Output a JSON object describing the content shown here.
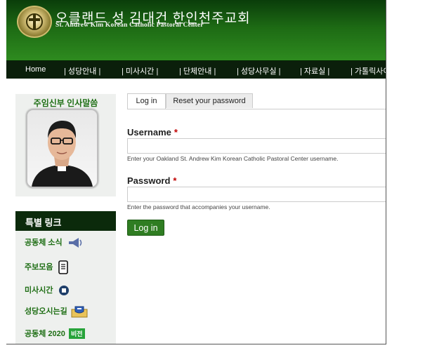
{
  "header": {
    "title_ko": "오클랜드 성 김대건 한인천주교회",
    "title_en": "St. Andrew Kim Korean Catholic Pastoral Center"
  },
  "nav": {
    "items": [
      "Home",
      "| 성당안내 |",
      "| 미사시간 |",
      "| 단체안내 |",
      "| 성당사무실 |",
      "| 자료실 |",
      "| 가톨릭사이"
    ]
  },
  "sidebar": {
    "pastor_title": "주임신부 인사말씀",
    "links_title": "특별 링크",
    "links": [
      {
        "label": "공동체 소식",
        "icon": "megaphone-icon"
      },
      {
        "label": "주보모음",
        "icon": "phone-document-icon"
      },
      {
        "label": "미사시간",
        "icon": "stop-circle-icon"
      },
      {
        "label": "성당오시는길",
        "icon": "map-road-icon"
      },
      {
        "label": "공동체 2020",
        "badge": "비전"
      }
    ]
  },
  "tabs": {
    "login": "Log in",
    "reset": "Reset your password"
  },
  "form": {
    "username_label": "Username",
    "username_help": "Enter your Oakland St. Andrew Kim Korean Catholic Pastoral Center username.",
    "password_label": "Password",
    "password_help": "Enter the password that accompanies your username.",
    "required_mark": "*",
    "submit_label": "Log in"
  },
  "colors": {
    "brand_green": "#1e6e14",
    "nav_bg": "#0b1f0b",
    "button_green": "#2f7d22",
    "required_red": "#c00000"
  }
}
